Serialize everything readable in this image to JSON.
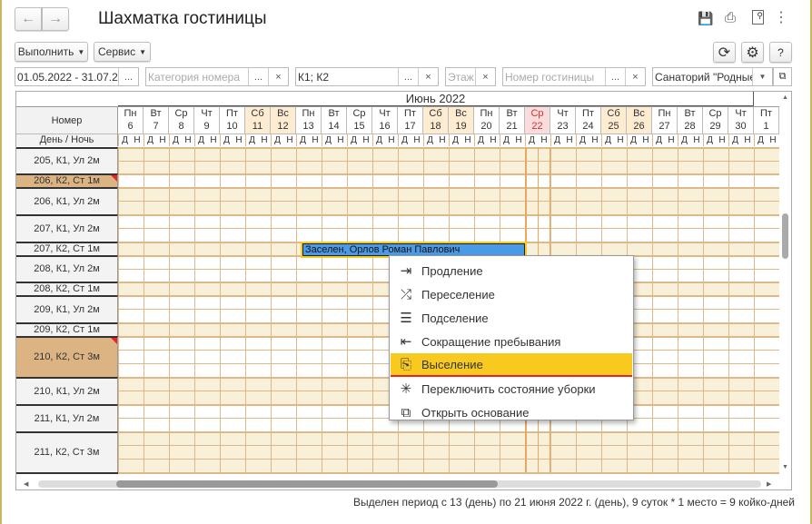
{
  "window": {
    "title": "Шахматка гостиницы"
  },
  "nav": {
    "back_icon": "arrow-left-icon",
    "forward_icon": "arrow-right-icon"
  },
  "header_icons": [
    "save-icon",
    "print-icon",
    "preview-icon",
    "more-icon"
  ],
  "toolbar": {
    "execute_label": "Выполнить",
    "service_label": "Сервис",
    "help_label": "?"
  },
  "filters": {
    "period": "01.05.2022 - 31.07.2022",
    "category_placeholder": "Категория номера",
    "buildings": "К1; К2",
    "floor_placeholder": "Этаж",
    "room_placeholder": "Номер гостиницы",
    "hotel": "Санаторий \"Родные г",
    "ellipsis": "...",
    "clear": "×"
  },
  "grid": {
    "month": "Июнь 2022",
    "room_header": "Номер",
    "daynight_header": "День / Ночь",
    "day_letter": "Д",
    "night_letter": "Н",
    "days": [
      {
        "wd": "Пн",
        "d": "6"
      },
      {
        "wd": "Вт",
        "d": "7"
      },
      {
        "wd": "Ср",
        "d": "8"
      },
      {
        "wd": "Чт",
        "d": "9"
      },
      {
        "wd": "Пт",
        "d": "10"
      },
      {
        "wd": "Сб",
        "d": "11",
        "weekend": true
      },
      {
        "wd": "Вс",
        "d": "12",
        "weekend": true
      },
      {
        "wd": "Пн",
        "d": "13"
      },
      {
        "wd": "Вт",
        "d": "14"
      },
      {
        "wd": "Ср",
        "d": "15"
      },
      {
        "wd": "Чт",
        "d": "16"
      },
      {
        "wd": "Пт",
        "d": "17"
      },
      {
        "wd": "Сб",
        "d": "18",
        "weekend": true
      },
      {
        "wd": "Вс",
        "d": "19",
        "weekend": true
      },
      {
        "wd": "Пн",
        "d": "20"
      },
      {
        "wd": "Вт",
        "d": "21"
      },
      {
        "wd": "Ср",
        "d": "22",
        "today": true
      },
      {
        "wd": "Чт",
        "d": "23"
      },
      {
        "wd": "Пт",
        "d": "24"
      },
      {
        "wd": "Сб",
        "d": "25",
        "weekend": true
      },
      {
        "wd": "Вс",
        "d": "26",
        "weekend": true
      },
      {
        "wd": "Пн",
        "d": "27"
      },
      {
        "wd": "Вт",
        "d": "28"
      },
      {
        "wd": "Ср",
        "d": "29"
      },
      {
        "wd": "Чт",
        "d": "30"
      },
      {
        "wd": "Пт",
        "d": "1"
      }
    ],
    "rooms": [
      {
        "label": "205, К1, Ул 2м"
      },
      {
        "label": "206, К2, Ст 1м",
        "highlight": true
      },
      {
        "label": "206, К1, Ул 2м"
      },
      {
        "label": "207, К1, Ул 2м"
      },
      {
        "label": "207, К2, Ст 1м"
      },
      {
        "label": "208, К1, Ул 2м"
      },
      {
        "label": "208, К2, Ст 1м"
      },
      {
        "label": "209, К1, Ул 2м"
      },
      {
        "label": "209, К2, Ст 1м"
      },
      {
        "label": "210, К2, Ст 3м",
        "highlight": true
      },
      {
        "label": "210, К1, Ул 2м"
      },
      {
        "label": "211, К1, Ул 2м"
      },
      {
        "label": "211, К2, Ст 3м"
      }
    ],
    "booking": {
      "text": "Заселен, Орлов Роман Павлович",
      "room": "207, К2, Ст 1м",
      "from": "13",
      "to": "21"
    }
  },
  "context_menu": [
    {
      "label": "Продление",
      "icon": "extend-icon"
    },
    {
      "label": "Переселение",
      "icon": "shuffle-icon"
    },
    {
      "label": "Подселение",
      "icon": "indent-icon"
    },
    {
      "label": "Сокращение пребывания",
      "icon": "shorten-icon"
    },
    {
      "label": "Выселение",
      "icon": "checkout-icon",
      "active": true
    },
    {
      "label": "Переключить состояние уборки",
      "icon": "magic-wand-icon"
    },
    {
      "label": "Открыть основание",
      "icon": "open-icon"
    }
  ],
  "status": "Выделен период с 13 (день) по 21 июня 2022 г. (день), 9 суток * 1 место = 9 койко-дней",
  "colors": {
    "weekend": "#fdebd2",
    "today": "#fadcdc",
    "shaded": "#f8f0d8",
    "grid_line": "#ddb98a",
    "booking": "#4a9ae8",
    "menu_active": "#f8c91e",
    "room_highlight": "#dcb484"
  }
}
